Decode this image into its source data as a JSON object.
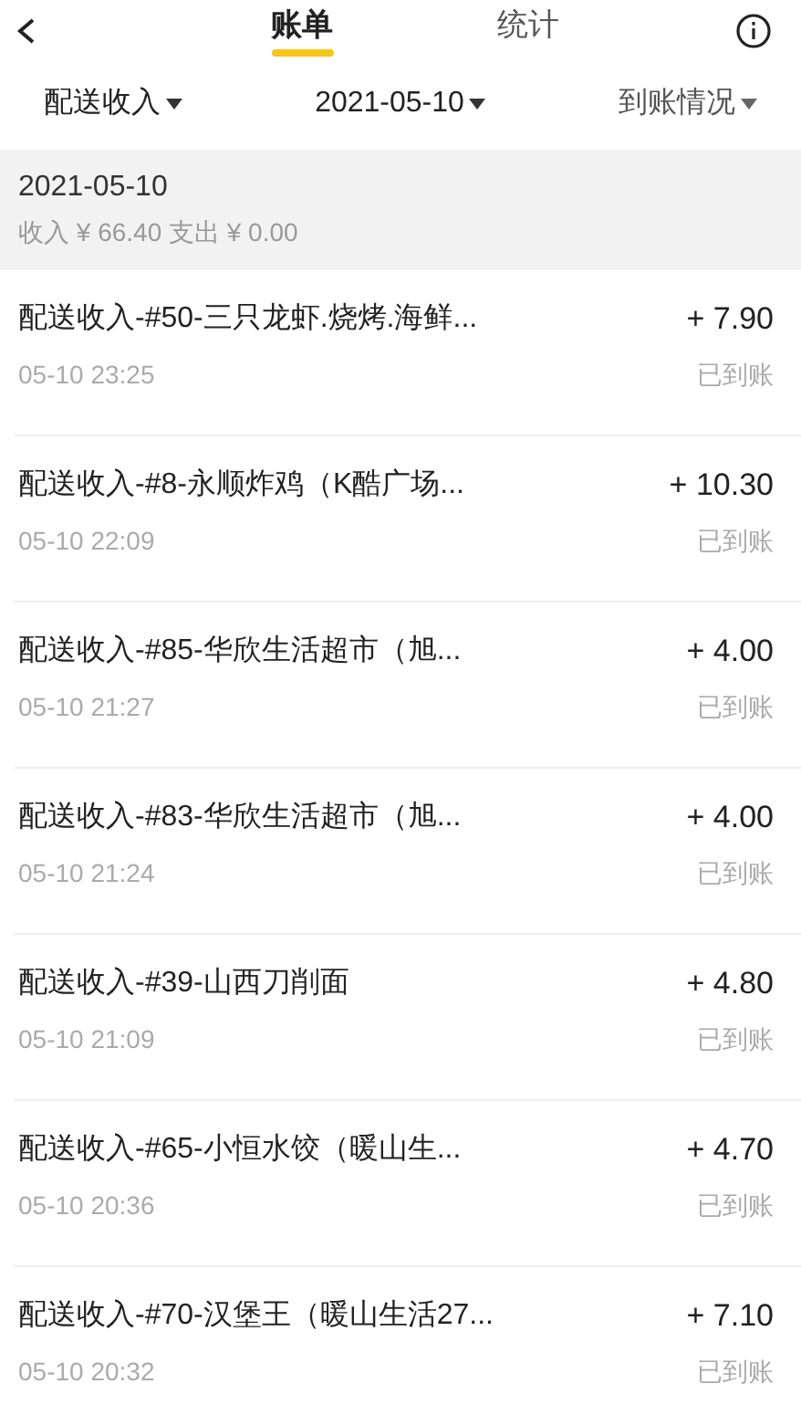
{
  "tabs": [
    {
      "label": "账单",
      "selected": true
    },
    {
      "label": "统计",
      "selected": false
    }
  ],
  "filters": [
    {
      "label": "配送收入"
    },
    {
      "label": "2021-05-10"
    },
    {
      "label": "到账情况"
    }
  ],
  "summary": {
    "date": "2021-05-10",
    "totals": "收入 ¥ 66.40 支出 ¥ 0.00"
  },
  "records": [
    {
      "title": "配送收入-#50-三只龙虾.烧烤.海鲜...",
      "time": "05-10 23:25",
      "amount": "+ 7.90",
      "status": "已到账"
    },
    {
      "title": "配送收入-#8-永顺炸鸡（K酷广场...",
      "time": "05-10 22:09",
      "amount": "+ 10.30",
      "status": "已到账"
    },
    {
      "title": "配送收入-#85-华欣生活超市（旭...",
      "time": "05-10 21:27",
      "amount": "+ 4.00",
      "status": "已到账"
    },
    {
      "title": "配送收入-#83-华欣生活超市（旭...",
      "time": "05-10 21:24",
      "amount": "+ 4.00",
      "status": "已到账"
    },
    {
      "title": "配送收入-#39-山西刀削面",
      "time": "05-10 21:09",
      "amount": "+ 4.80",
      "status": "已到账"
    },
    {
      "title": "配送收入-#65-小恒水饺（暖山生...",
      "time": "05-10 20:36",
      "amount": "+ 4.70",
      "status": "已到账"
    },
    {
      "title": "配送收入-#70-汉堡王（暖山生活27...",
      "time": "05-10 20:32",
      "amount": "+ 7.10",
      "status": "已到账"
    }
  ]
}
